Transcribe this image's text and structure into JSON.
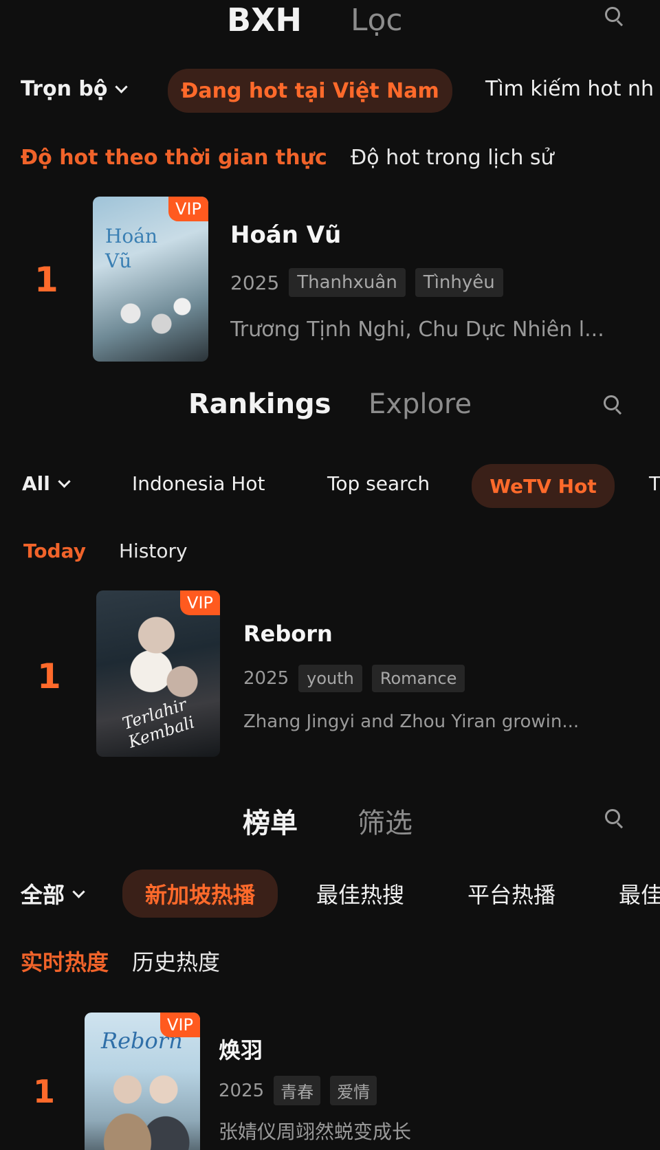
{
  "vn": {
    "tab_main": "BXH",
    "tab_sec": "Lọc",
    "filter_all": "Trọn bộ",
    "filter_active": "Đang hot tại Việt Nam",
    "filter_next": "Tìm kiếm hot nh",
    "sub_on": "Độ hot theo thời gian thực",
    "sub_off": "Độ hot trong lịch sử",
    "rank": "1",
    "vip": "VIP",
    "poster_text": "Hoán Vũ",
    "title": "Hoán Vũ",
    "year": "2025",
    "tags": [
      "Thanhxuân",
      "Tìnhyêu"
    ],
    "desc": "Trương Tịnh Nghi, Chu Dực Nhiên l..."
  },
  "en": {
    "tab_main": "Rankings",
    "tab_sec": "Explore",
    "filter_all": "All",
    "filters": [
      "Indonesia Hot",
      "Top search"
    ],
    "filter_active": "WeTV Hot",
    "filter_next": "T",
    "sub_on": "Today",
    "sub_off": "History",
    "rank": "1",
    "vip": "VIP",
    "poster_text": "Terlahir Kembali",
    "title": "Reborn",
    "year": "2025",
    "tags": [
      "youth",
      "Romance"
    ],
    "desc": "Zhang Jingyi and Zhou Yiran growin..."
  },
  "zh": {
    "tab_main": "榜单",
    "tab_sec": "筛选",
    "filter_all": "全部",
    "filter_active": "新加坡热播",
    "filters": [
      "最佳热搜",
      "平台热播",
      "最佳"
    ],
    "sub_on": "实时热度",
    "sub_off": "历史热度",
    "rank": "1",
    "vip": "VIP",
    "poster_text": "Reborn",
    "title": "焕羽",
    "year": "2025",
    "tags": [
      "青春",
      "爱情"
    ],
    "desc": "张婧仪周翊然蜕变成长"
  },
  "colors": {
    "accent": "#ff6a2b",
    "active_chip_bg": "#3a2018",
    "background": "#0f0f0f"
  }
}
